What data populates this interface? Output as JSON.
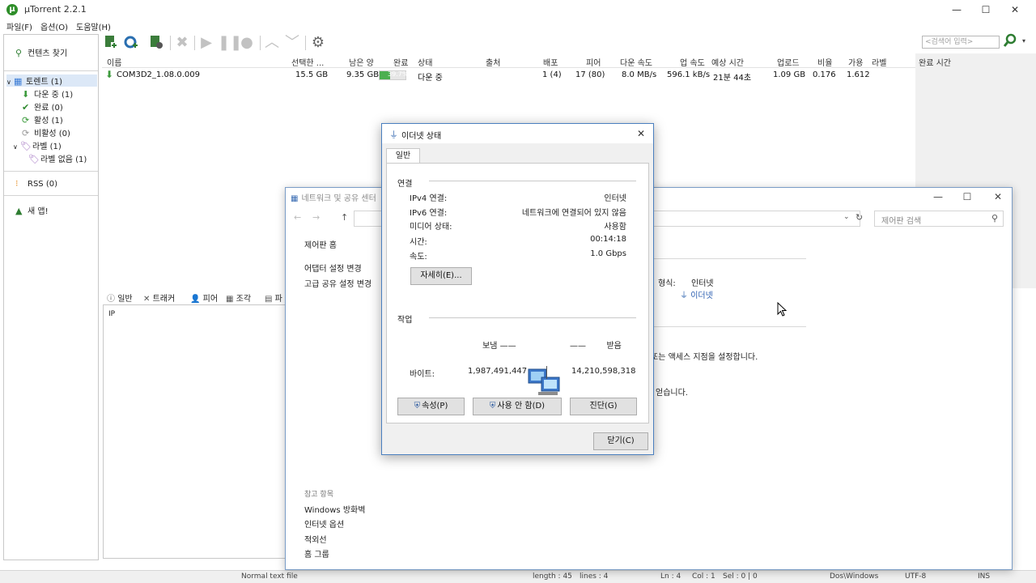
{
  "utorrent": {
    "title": "µTorrent 2.2.1",
    "menu": [
      "파일(F)",
      "옵션(O)",
      "도움말(H)"
    ],
    "search_placeholder": "<검색어 입력>",
    "sidebar": {
      "find_content": "컨텐츠 찾기",
      "torrents": "토렌트 (1)",
      "downloading": "다운 중 (1)",
      "completed": "완료 (0)",
      "active": "활성 (1)",
      "inactive": "비활성 (0)",
      "labels": "라벨 (1)",
      "no_label": "라벨 없음 (1)",
      "rss": "RSS (0)",
      "new_app": "새 앱!"
    },
    "columns": [
      "이름",
      "선택한 ...",
      "남은 양",
      "완료",
      "상태",
      "출처",
      "배포",
      "피어",
      "다운 속도",
      "업 속도",
      "예상 시간",
      "업로드",
      "비율",
      "가용",
      "라벨",
      "완료 시간"
    ],
    "torrent": {
      "name": "COM3D2_1.08.0.009",
      "selected": "15.5 GB",
      "remaining": "9.35 GB",
      "progress": 0.397,
      "progress_text": "39.7%",
      "status": "다운 중",
      "seeds": "1 (4)",
      "peers": "17 (80)",
      "down_speed": "8.0 MB/s",
      "up_speed": "596.1 kB/s",
      "eta": "21분 44초",
      "uploaded": "1.09 GB",
      "ratio": "0.176",
      "availability": "1.612"
    },
    "detail_tabs": [
      "일반",
      "트래커",
      "피어",
      "조각",
      "파"
    ],
    "detail_ip_header": "IP",
    "status_bar": [
      "Normal text file",
      "length : 45",
      "lines : 4",
      "Ln : 4",
      "Col : 1",
      "Sel : 0 | 0",
      "Dos\\Windows",
      "UTF-8",
      "INS"
    ]
  },
  "network_center": {
    "title": "네트워크 및 공유 센터",
    "search_placeholder": "제어판 검색",
    "left_links": [
      "제어판 홈",
      "어댑터 설정 변경",
      "고급 공유 설정 변경"
    ],
    "see_also_heading": "참고 항목",
    "see_also": [
      "Windows 방화벽",
      "인터넷 옵션",
      "적외선",
      "홈 그룹"
    ],
    "access_type_label": "형식:",
    "access_type_value": "인터넷",
    "connection_link": "이더넷",
    "text_setup": "또는 액세스 지점을 설정합니다.",
    "text_troubleshoot": "얻습니다."
  },
  "ethernet_status": {
    "title": "이더넷 상태",
    "tab": "일반",
    "connection_heading": "연결",
    "rows": [
      {
        "k": "IPv4 연결:",
        "v": "인터넷"
      },
      {
        "k": "IPv6 연결:",
        "v": "네트워크에 연결되어 있지 않음"
      },
      {
        "k": "미디어 상태:",
        "v": "사용함"
      },
      {
        "k": "시간:",
        "v": "00:14:18"
      },
      {
        "k": "속도:",
        "v": "1.0 Gbps"
      }
    ],
    "details_button": "자세히(E)...",
    "activity_heading": "작업",
    "sent_label": "보냄",
    "received_label": "받음",
    "bytes_label": "바이트:",
    "bytes_sent": "1,987,491,447",
    "bytes_received": "14,210,598,318",
    "properties_button": "속성(P)",
    "disable_button": "사용 안 함(D)",
    "diagnose_button": "진단(G)",
    "close_button": "닫기(C)"
  }
}
